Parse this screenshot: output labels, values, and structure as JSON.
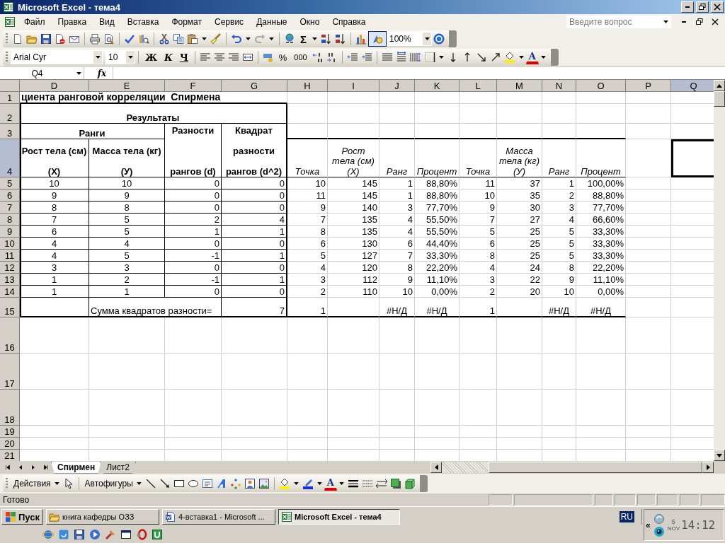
{
  "window": {
    "title": "Microsoft Excel - тема4"
  },
  "menu": [
    "Файл",
    "Правка",
    "Вид",
    "Вставка",
    "Формат",
    "Сервис",
    "Данные",
    "Окно",
    "Справка"
  ],
  "help_search": {
    "placeholder": "Введите вопрос"
  },
  "standard_toolbar": {
    "sigma": "Σ",
    "zoom": "100%",
    "drawing_active": true
  },
  "formatting_toolbar": {
    "font": "Arial Cyr",
    "size": "10",
    "bold": "Ж",
    "italic": "К",
    "underline": "Ч",
    "percent": "%",
    "thousands": "000",
    "font_color": "A"
  },
  "formula_bar": {
    "name_box": "Q4",
    "fx": "fx"
  },
  "sheet": {
    "columns": [
      {
        "label": "D",
        "selected": false
      },
      {
        "label": "E",
        "selected": false
      },
      {
        "label": "F",
        "selected": false
      },
      {
        "label": "G",
        "selected": false
      },
      {
        "label": "H",
        "selected": false
      },
      {
        "label": "I",
        "selected": false
      },
      {
        "label": "J",
        "selected": false
      },
      {
        "label": "K",
        "selected": false
      },
      {
        "label": "L",
        "selected": false
      },
      {
        "label": "M",
        "selected": false
      },
      {
        "label": "N",
        "selected": false
      },
      {
        "label": "O",
        "selected": false
      },
      {
        "label": "P",
        "selected": false
      },
      {
        "label": "Q",
        "selected": true
      }
    ],
    "rows": [
      {
        "number": "1",
        "selected": false,
        "cells": [
          {
            "text": "циента ранговой корреляции  Спирмена",
            "kind": "title"
          }
        ]
      },
      {
        "number": "2",
        "selected": false,
        "cells": [
          {
            "text": "Результаты",
            "kind": "header"
          }
        ]
      },
      {
        "number": "3",
        "selected": false,
        "cells": [
          {
            "text": "Ранги",
            "kind": "header"
          },
          null,
          {
            "text": "Разности\n\n\n\nрангов (d)",
            "kind": "header"
          },
          {
            "text": "Квадрат\n\nразности\n\nрангов (d^2)",
            "kind": "header"
          }
        ]
      },
      {
        "number": "4",
        "selected": true,
        "cells": [
          {
            "text": "Рост тела (см)\n\n(X)",
            "kind": "header"
          },
          {
            "text": "Масса тела (кг)\n\n(У)",
            "kind": "header"
          },
          null,
          null,
          {
            "text": "Точка",
            "kind": "caption"
          },
          {
            "text": "Рост\nтела (см)\n(X)",
            "kind": "caption"
          },
          {
            "text": "Ранг",
            "kind": "caption"
          },
          {
            "text": "Процент",
            "kind": "caption"
          },
          {
            "text": "Точка",
            "kind": "caption"
          },
          {
            "text": "Масса\nтела (кг)\n(У)",
            "kind": "caption"
          },
          {
            "text": "Ранг",
            "kind": "caption"
          },
          {
            "text": "Процент",
            "kind": "caption"
          }
        ]
      },
      {
        "number": "5",
        "selected": false,
        "cells": [
          {
            "text": "10",
            "kind": "number"
          },
          {
            "text": "10",
            "kind": "number"
          },
          {
            "text": "0",
            "kind": "number"
          },
          {
            "text": "0",
            "kind": "number"
          },
          {
            "text": "10",
            "kind": "number"
          },
          {
            "text": "145",
            "kind": "number"
          },
          {
            "text": "1",
            "kind": "number"
          },
          {
            "text": "88,80%",
            "kind": "number"
          },
          {
            "text": "11",
            "kind": "number"
          },
          {
            "text": "37",
            "kind": "number"
          },
          {
            "text": "1",
            "kind": "number"
          },
          {
            "text": "100,00%",
            "kind": "number"
          }
        ]
      },
      {
        "number": "6",
        "selected": false,
        "cells": [
          {
            "text": "9",
            "kind": "number"
          },
          {
            "text": "9",
            "kind": "number"
          },
          {
            "text": "0",
            "kind": "number"
          },
          {
            "text": "0",
            "kind": "number"
          },
          {
            "text": "11",
            "kind": "number"
          },
          {
            "text": "145",
            "kind": "number"
          },
          {
            "text": "1",
            "kind": "number"
          },
          {
            "text": "88,80%",
            "kind": "number"
          },
          {
            "text": "10",
            "kind": "number"
          },
          {
            "text": "35",
            "kind": "number"
          },
          {
            "text": "2",
            "kind": "number"
          },
          {
            "text": "88,80%",
            "kind": "number"
          }
        ]
      },
      {
        "number": "7",
        "selected": false,
        "cells": [
          {
            "text": "8",
            "kind": "number"
          },
          {
            "text": "8",
            "kind": "number"
          },
          {
            "text": "0",
            "kind": "number"
          },
          {
            "text": "0",
            "kind": "number"
          },
          {
            "text": "9",
            "kind": "number"
          },
          {
            "text": "140",
            "kind": "number"
          },
          {
            "text": "3",
            "kind": "number"
          },
          {
            "text": "77,70%",
            "kind": "number"
          },
          {
            "text": "9",
            "kind": "number"
          },
          {
            "text": "30",
            "kind": "number"
          },
          {
            "text": "3",
            "kind": "number"
          },
          {
            "text": "77,70%",
            "kind": "number"
          }
        ]
      },
      {
        "number": "8",
        "selected": false,
        "cells": [
          {
            "text": "7",
            "kind": "number"
          },
          {
            "text": "5",
            "kind": "number"
          },
          {
            "text": "2",
            "kind": "number"
          },
          {
            "text": "4",
            "kind": "number"
          },
          {
            "text": "7",
            "kind": "number"
          },
          {
            "text": "135",
            "kind": "number"
          },
          {
            "text": "4",
            "kind": "number"
          },
          {
            "text": "55,50%",
            "kind": "number"
          },
          {
            "text": "7",
            "kind": "number"
          },
          {
            "text": "27",
            "kind": "number"
          },
          {
            "text": "4",
            "kind": "number"
          },
          {
            "text": "66,60%",
            "kind": "number"
          }
        ]
      },
      {
        "number": "9",
        "selected": false,
        "cells": [
          {
            "text": "6",
            "kind": "number"
          },
          {
            "text": "5",
            "kind": "number"
          },
          {
            "text": "1",
            "kind": "number"
          },
          {
            "text": "1",
            "kind": "number"
          },
          {
            "text": "8",
            "kind": "number"
          },
          {
            "text": "135",
            "kind": "number"
          },
          {
            "text": "4",
            "kind": "number"
          },
          {
            "text": "55,50%",
            "kind": "number"
          },
          {
            "text": "5",
            "kind": "number"
          },
          {
            "text": "25",
            "kind": "number"
          },
          {
            "text": "5",
            "kind": "number"
          },
          {
            "text": "33,30%",
            "kind": "number"
          }
        ]
      },
      {
        "number": "10",
        "selected": false,
        "cells": [
          {
            "text": "4",
            "kind": "number"
          },
          {
            "text": "4",
            "kind": "number"
          },
          {
            "text": "0",
            "kind": "number"
          },
          {
            "text": "0",
            "kind": "number"
          },
          {
            "text": "6",
            "kind": "number"
          },
          {
            "text": "130",
            "kind": "number"
          },
          {
            "text": "6",
            "kind": "number"
          },
          {
            "text": "44,40%",
            "kind": "number"
          },
          {
            "text": "6",
            "kind": "number"
          },
          {
            "text": "25",
            "kind": "number"
          },
          {
            "text": "5",
            "kind": "number"
          },
          {
            "text": "33,30%",
            "kind": "number"
          }
        ]
      },
      {
        "number": "11",
        "selected": false,
        "cells": [
          {
            "text": "4",
            "kind": "number"
          },
          {
            "text": "5",
            "kind": "number"
          },
          {
            "text": "-1",
            "kind": "number"
          },
          {
            "text": "1",
            "kind": "number"
          },
          {
            "text": "5",
            "kind": "number"
          },
          {
            "text": "127",
            "kind": "number"
          },
          {
            "text": "7",
            "kind": "number"
          },
          {
            "text": "33,30%",
            "kind": "number"
          },
          {
            "text": "8",
            "kind": "number"
          },
          {
            "text": "25",
            "kind": "number"
          },
          {
            "text": "5",
            "kind": "number"
          },
          {
            "text": "33,30%",
            "kind": "number"
          }
        ]
      },
      {
        "number": "12",
        "selected": false,
        "cells": [
          {
            "text": "3",
            "kind": "number"
          },
          {
            "text": "3",
            "kind": "number"
          },
          {
            "text": "0",
            "kind": "number"
          },
          {
            "text": "0",
            "kind": "number"
          },
          {
            "text": "4",
            "kind": "number"
          },
          {
            "text": "120",
            "kind": "number"
          },
          {
            "text": "8",
            "kind": "number"
          },
          {
            "text": "22,20%",
            "kind": "number"
          },
          {
            "text": "4",
            "kind": "number"
          },
          {
            "text": "24",
            "kind": "number"
          },
          {
            "text": "8",
            "kind": "number"
          },
          {
            "text": "22,20%",
            "kind": "number"
          }
        ]
      },
      {
        "number": "13",
        "selected": false,
        "cells": [
          {
            "text": "1",
            "kind": "number"
          },
          {
            "text": "2",
            "kind": "number"
          },
          {
            "text": "-1",
            "kind": "number"
          },
          {
            "text": "1",
            "kind": "number"
          },
          {
            "text": "3",
            "kind": "number"
          },
          {
            "text": "112",
            "kind": "number"
          },
          {
            "text": "9",
            "kind": "number"
          },
          {
            "text": "11,10%",
            "kind": "number"
          },
          {
            "text": "3",
            "kind": "number"
          },
          {
            "text": "22",
            "kind": "number"
          },
          {
            "text": "9",
            "kind": "number"
          },
          {
            "text": "11,10%",
            "kind": "number"
          }
        ]
      },
      {
        "number": "14",
        "selected": false,
        "cells": [
          {
            "text": "1",
            "kind": "number"
          },
          {
            "text": "1",
            "kind": "number"
          },
          {
            "text": "0",
            "kind": "number"
          },
          {
            "text": "0",
            "kind": "number"
          },
          {
            "text": "2",
            "kind": "number"
          },
          {
            "text": "110",
            "kind": "number"
          },
          {
            "text": "10",
            "kind": "number"
          },
          {
            "text": "0,00%",
            "kind": "number"
          },
          {
            "text": "2",
            "kind": "number"
          },
          {
            "text": "20",
            "kind": "number"
          },
          {
            "text": "10",
            "kind": "number"
          },
          {
            "text": "0,00%",
            "kind": "number"
          }
        ]
      },
      {
        "number": "15",
        "selected": false,
        "cells": [
          null,
          {
            "text": "Сумма квадратов разности=",
            "kind": "label"
          },
          null,
          {
            "text": "7",
            "kind": "number"
          },
          {
            "text": "1",
            "kind": "number"
          },
          null,
          {
            "text": "#Н/Д",
            "kind": "error"
          },
          {
            "text": "#Н/Д",
            "kind": "error"
          },
          {
            "text": "1",
            "kind": "number"
          },
          null,
          {
            "text": "#Н/Д",
            "kind": "error"
          },
          {
            "text": "#Н/Д",
            "kind": "error"
          }
        ]
      },
      {
        "number": "16",
        "selected": false
      },
      {
        "number": "17",
        "selected": false
      },
      {
        "number": "18",
        "selected": false
      },
      {
        "number": "19",
        "selected": false
      },
      {
        "number": "20",
        "selected": false
      },
      {
        "number": "21",
        "selected": false
      }
    ]
  },
  "sheet_tabs": [
    {
      "label": "Спирмен",
      "selected": true
    },
    {
      "label": "Лист2",
      "selected": false
    }
  ],
  "drawing_toolbar": {
    "actions": "Действия",
    "autoshapes": "Автофигуры",
    "font_color": "A"
  },
  "status_bar": {
    "text": "Готово"
  },
  "taskbar": {
    "start": "Пуск",
    "tasks": [
      {
        "label": "книга кафедры ОЗЗ",
        "kind": "folder",
        "selected": false
      },
      {
        "label": "4-вставка1 - Microsoft ...",
        "kind": "word",
        "selected": false
      },
      {
        "label": "Microsoft Excel - тема4",
        "kind": "excel",
        "selected": true
      }
    ],
    "language": "RU",
    "tray_expand": "«",
    "date_day": "5",
    "date_month": "NOV",
    "clock": "14:12"
  }
}
